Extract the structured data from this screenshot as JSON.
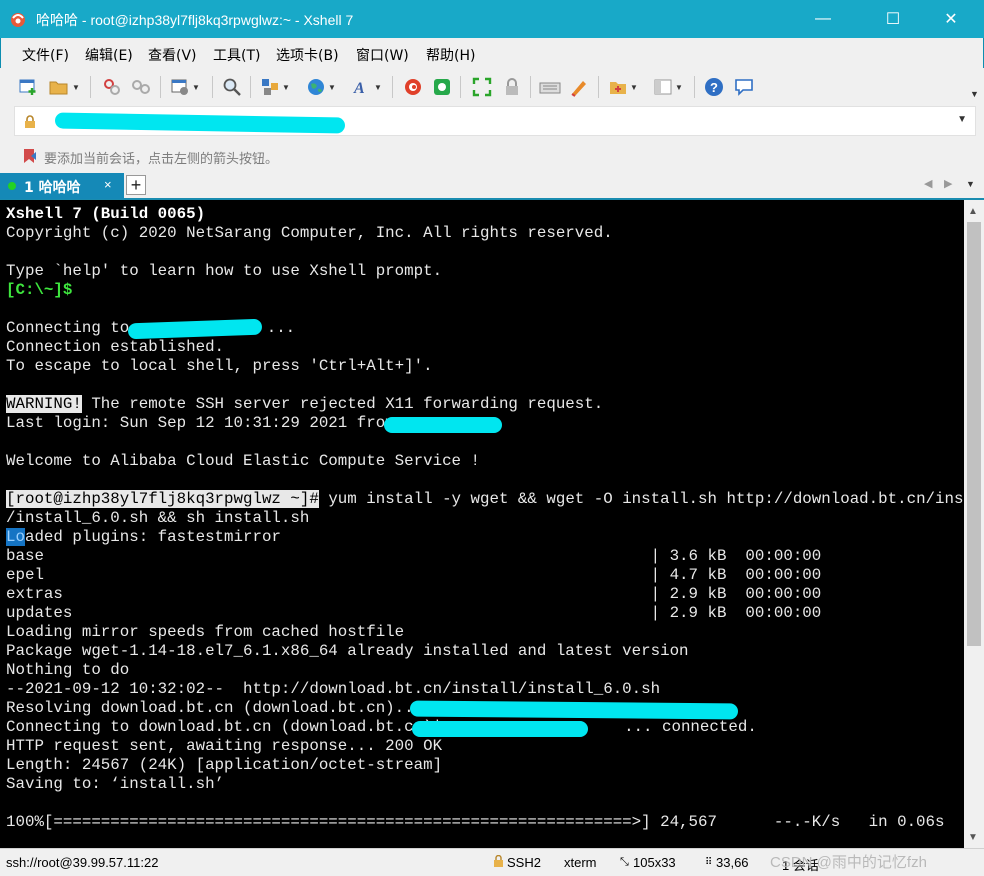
{
  "window": {
    "title": "哈哈哈 - root@izhp38yl7flj8kq3rpwglwz:~ - Xshell 7",
    "minimize": "—",
    "maximize": "☐",
    "close": "✕"
  },
  "menu": [
    "文件(F)",
    "编辑(E)",
    "查看(V)",
    "工具(T)",
    "选项卡(B)",
    "窗口(W)",
    "帮助(H)"
  ],
  "hint": {
    "text": "要添加当前会话，点击左侧的箭头按钮。"
  },
  "tabs": {
    "active_label": "1 哈哈哈",
    "close": "×",
    "add": "+"
  },
  "terminal": {
    "lines": {
      "l1": "Xshell 7 (Build 0065)",
      "l2": "Copyright (c) 2020 NetSarang Computer, Inc. All rights reserved.",
      "l3": "Type `help' to learn how to use Xshell prompt.",
      "l4": "[C:\\~]$",
      "l5a": "Connecting to ",
      "l5b": "...",
      "l6": "Connection established.",
      "l7": "To escape to local shell, press 'Ctrl+Alt+]'.",
      "l8a": "WARNING!",
      "l8b": " The remote SSH server rejected X11 forwarding request.",
      "l9": "Last login: Sun Sep 12 10:31:29 2021 from ",
      "l10": "Welcome to Alibaba Cloud Elastic Compute Service !",
      "l11a": "[root@izhp38yl7flj8kq3rpwglwz ~]#",
      "l11b": " yum install -y wget && wget -O install.sh http://download.bt.cn/install",
      "l12": "/install_6.0.sh && sh install.sh",
      "l13a": "Lo",
      "l13b": "aded plugins: fastestmirror",
      "repo1": "base                                                                | 3.6 kB  00:00:00",
      "repo2": "epel                                                                | 4.7 kB  00:00:00",
      "repo3": "extras                                                              | 2.9 kB  00:00:00",
      "repo4": "updates                                                             | 2.9 kB  00:00:00",
      "l18": "Loading mirror speeds from cached hostfile",
      "l19": "Package wget-1.14-18.el7_6.1.x86_64 already installed and latest version",
      "l20": "Nothing to do",
      "l21": "--2021-09-12 10:32:02--  http://download.bt.cn/install/install_6.0.sh",
      "l22": "Resolving download.bt.cn (download.bt.cn)... ",
      "l23a": "Connecting to download.bt.cn (download.bt.cn)|",
      "l23b": "... connected.",
      "l24": "HTTP request sent, awaiting response... 200 OK",
      "l25": "Length: 24567 (24K) [application/octet-stream]",
      "l26": "Saving to: ‘install.sh’",
      "l27": "100%[=============================================================>] 24,567      --.-K/s   in 0.06s"
    }
  },
  "status": {
    "connection": "ssh://root@39.99.57.11:22",
    "protocol": "SSH2",
    "term": "xterm",
    "size": "105x33",
    "cursor": "33,66",
    "sessions": "1 会话",
    "watermark": "CSDN @雨中的记忆fzh"
  },
  "colors": {
    "titlebar": "#18a9c8",
    "tab_active": "#1589b7",
    "terminal_bg": "#000000",
    "prompt_green": "#3ee63e",
    "redaction": "#00e6f0"
  }
}
